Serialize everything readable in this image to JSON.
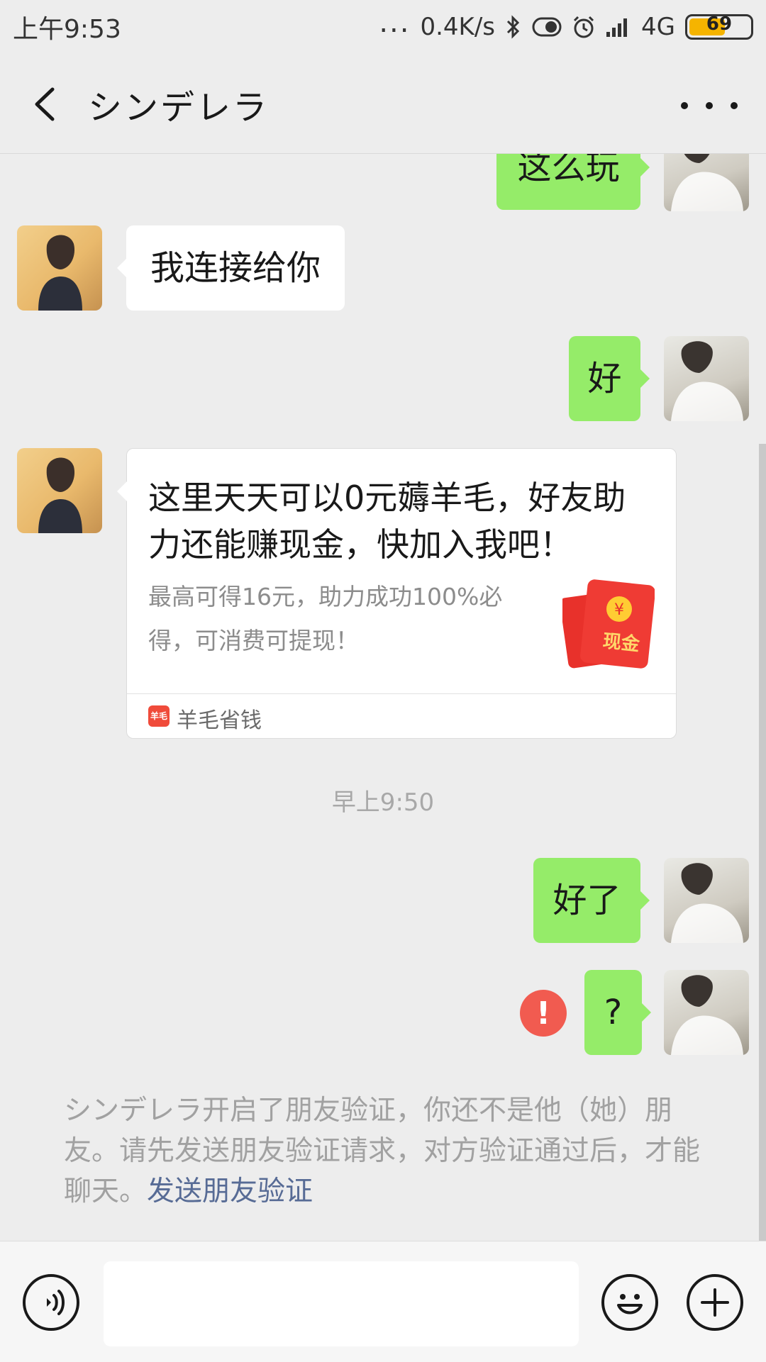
{
  "status_bar": {
    "time": "上午9:53",
    "dots": "...",
    "net_speed": "0.4K/s",
    "network": "4G",
    "battery": "69"
  },
  "header": {
    "title": "シンデレラ",
    "back_icon": "chevron-left-icon",
    "more_icon": "more-horizontal-icon"
  },
  "messages": [
    {
      "from": "me",
      "text": "这么玩"
    },
    {
      "from": "her",
      "text": "我连接给你"
    },
    {
      "from": "me",
      "text": "好"
    },
    {
      "from": "her",
      "card": {
        "title": "这里天天可以0元薅羊毛，好友助力还能赚现金，快加入我吧！",
        "description": "最高可得16元，助力成功100%必得，可消费可提现！",
        "image_badge": "现金",
        "image_symbol": "¥",
        "app_icon_text": "羊毛",
        "app_name": "羊毛省钱"
      }
    },
    {
      "timestamp": "早上9:50"
    },
    {
      "from": "me",
      "text": "好了"
    },
    {
      "from": "me",
      "text": "?",
      "status": "failed",
      "status_icon": "!"
    }
  ],
  "system_notice": {
    "text": "シンデレラ开启了朋友验证，你还不是他（她）朋友。请先发送朋友验证请求，对方验证通过后，才能聊天。",
    "link": "发送朋友验证"
  },
  "input_bar": {
    "value": "",
    "voice_icon": "voice-icon",
    "emoji_icon": "emoji-icon",
    "plus_icon": "plus-icon"
  },
  "colors": {
    "background": "#ededed",
    "my_bubble": "#95ec69",
    "their_bubble": "#ffffff",
    "link": "#576b95",
    "error": "#f15b50"
  }
}
